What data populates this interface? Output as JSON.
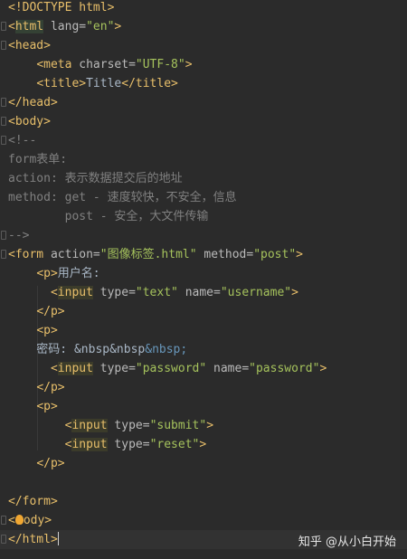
{
  "lines": [
    "<!DOCTYPE html>",
    "<html lang=\"en\">",
    "<head>",
    "    <meta charset=\"UTF-8\">",
    "    <title>Title</title>",
    "</head>",
    "<body>",
    "<!--",
    "form表单:",
    "action: 表示数据提交后的地址",
    "method: get - 速度较快，不安全，信息",
    "        post - 安全，大文件传输",
    "-->",
    "<form action=\"图像标签.html\" method=\"post\">",
    "    <p>用户名:",
    "      <input type=\"text\" name=\"username\">",
    "    </p>",
    "    <p>",
    "    密码: &nbsp&nbsp&nbsp;",
    "      <input type=\"password\" name=\"password\">",
    "    </p>",
    "    <p>",
    "        <input type=\"submit\">",
    "        <input type=\"reset\">",
    "    </p>",
    "",
    "</form>",
    "</body>",
    "</html>"
  ],
  "watermark": "知乎 @从小白开始",
  "colors": {
    "background": "#2b2b2b",
    "tag": "#e8bf6a",
    "attr": "#bababa",
    "value": "#a5c25c",
    "text": "#a9b7c6",
    "comment": "#808080",
    "entity": "#6897bb"
  }
}
